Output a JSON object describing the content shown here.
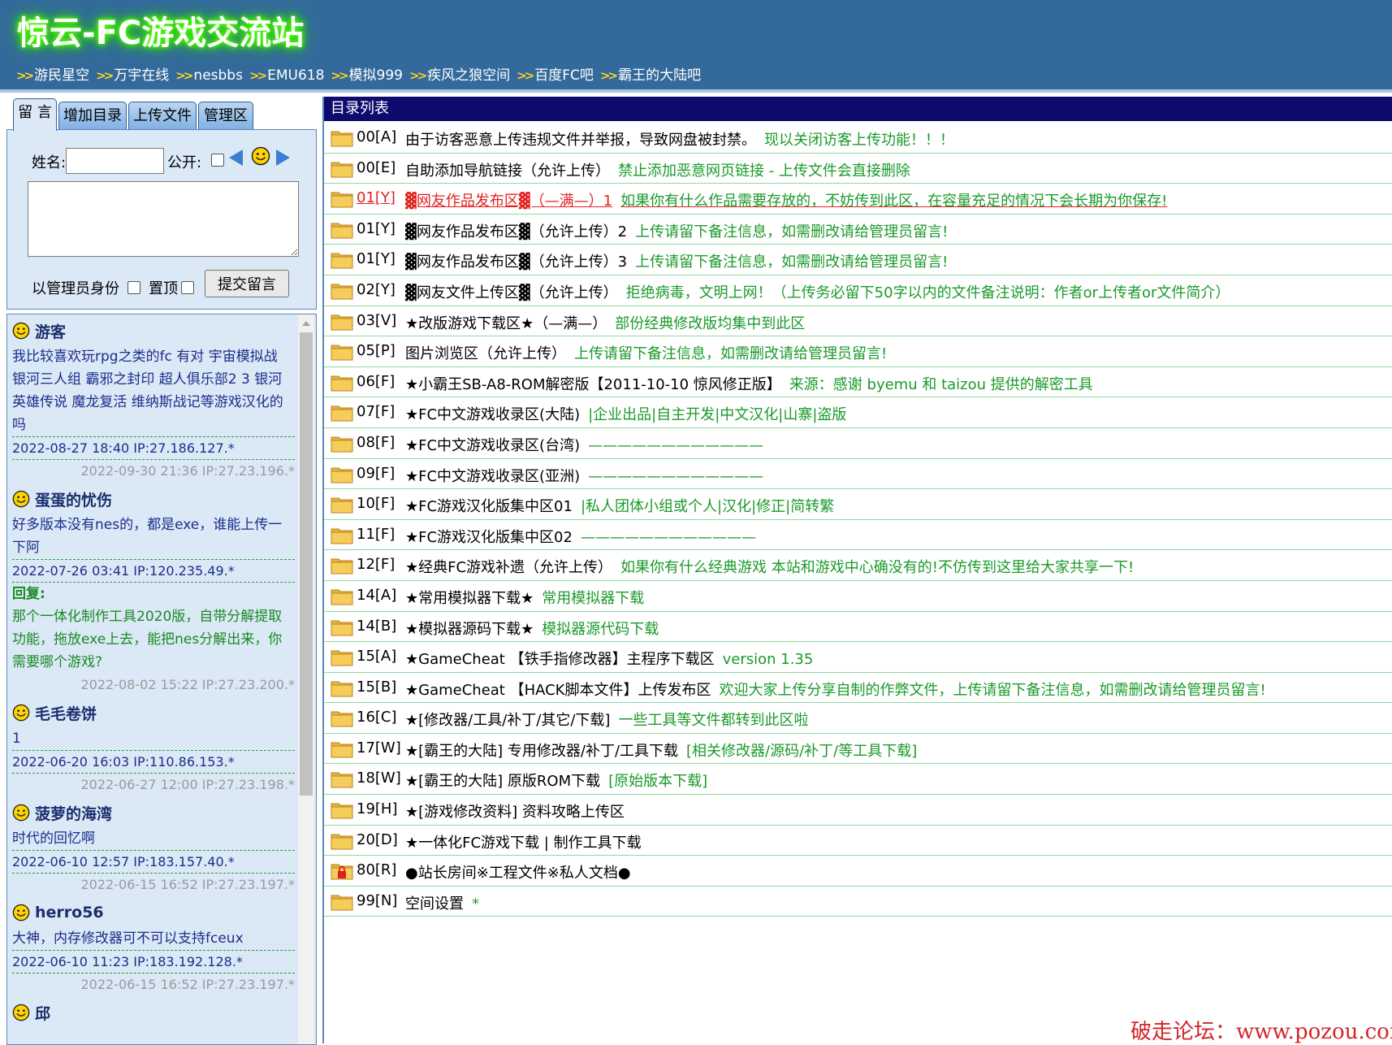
{
  "site_title": "惊云-FC游戏交流站",
  "nav_links": [
    "游民星空",
    "万宇在线",
    "nesbbs",
    "EMU618",
    "模拟999",
    "疾风之狼空间",
    "百度FC吧",
    "霸王的大陆吧"
  ],
  "tabs": [
    "留 言",
    "增加目录",
    "上传文件",
    "管理区"
  ],
  "form": {
    "name_label": "姓名:",
    "name_value": "",
    "public_label": "公开:",
    "admin_label": "以管理员身份",
    "pin_label": "置顶",
    "submit_label": "提交留言"
  },
  "messages": [
    {
      "name": "游客",
      "text": "我比较喜欢玩rpg之类的fc 有对 宇宙模拟战 银河三人组 霸邪之封印 超人俱乐部2 3 银河英雄传说 魔龙复活 维纳斯战记等游戏汉化的吗",
      "posted": "2022-08-27 18:40 IP:27.186.127.*",
      "reply_title": "",
      "reply": "",
      "replied": "2022-09-30 21:36 IP:27.23.196.*"
    },
    {
      "name": "蛋蛋的忧伤",
      "text": "好多版本没有nes的，都是exe，谁能上传一下阿",
      "posted": "2022-07-26 03:41 IP:120.235.49.*",
      "reply_title": "回复:",
      "reply": "那个一体化制作工具2020版，自带分解提取功能，拖放exe上去，能把nes分解出来，你需要哪个游戏?",
      "replied": "2022-08-02 15:22 IP:27.23.200.*"
    },
    {
      "name": "毛毛卷饼",
      "text": "1",
      "posted": "2022-06-20 16:03 IP:110.86.153.*",
      "reply_title": "",
      "reply": "",
      "replied": "2022-06-27 12:00 IP:27.23.198.*"
    },
    {
      "name": "菠萝的海湾",
      "text": "时代的回忆啊",
      "posted": "2022-06-10 12:57 IP:183.157.40.*",
      "reply_title": "",
      "reply": "",
      "replied": "2022-06-15 16:52 IP:27.23.197.*"
    },
    {
      "name": "herro56",
      "text": "大神，内存修改器可不可以支持fceux",
      "posted": "2022-06-10 11:23 IP:183.192.128.*",
      "reply_title": "",
      "reply": "",
      "replied": "2022-06-15 16:52 IP:27.23.197.*"
    },
    {
      "name": "邱",
      "text": "",
      "posted": "",
      "reply_title": "",
      "reply": "",
      "replied": ""
    }
  ],
  "directory": {
    "header": "目录列表",
    "rows": [
      {
        "code": "00[A]",
        "title": "由于访客恶意上传违规文件并举报，导致网盘被封禁。",
        "desc": "现以关闭访客上传功能！！！",
        "icon": "folder-icon",
        "highlight": false
      },
      {
        "code": "00[E]",
        "title": "自助添加导航链接（允许上传）",
        "desc": "禁止添加恶意网页链接 - 上传文件会直接删除",
        "icon": "folder-icon",
        "highlight": false
      },
      {
        "code": "01[Y]",
        "title": "▓网友作品发布区▓（—满—）1",
        "desc": "如果你有什么作品需要存放的，不妨传到此区，在容量充足的情况下会长期为你保存!",
        "icon": "folder-icon",
        "highlight": true
      },
      {
        "code": "01[Y]",
        "title": "▓网友作品发布区▓（允许上传）2",
        "desc": "上传请留下备注信息，如需删改请给管理员留言!",
        "icon": "folder-icon",
        "highlight": false
      },
      {
        "code": "01[Y]",
        "title": "▓网友作品发布区▓（允许上传）3",
        "desc": "上传请留下备注信息，如需删改请给管理员留言!",
        "icon": "folder-icon",
        "highlight": false
      },
      {
        "code": "02[Y]",
        "title": "▓网友文件上传区▓（允许上传）",
        "desc": "拒绝病毒，文明上网！（上传务必留下50字以内的文件备注说明：作者or上传者or文件简介）",
        "icon": "folder-icon",
        "highlight": false
      },
      {
        "code": "03[V]",
        "title": "★改版游戏下载区★（—满—）",
        "desc": "部份经典修改版均集中到此区",
        "icon": "folder-icon",
        "highlight": false
      },
      {
        "code": "05[P]",
        "title": "图片浏览区（允许上传）",
        "desc": "上传请留下备注信息，如需删改请给管理员留言!",
        "icon": "folder-icon",
        "highlight": false
      },
      {
        "code": "06[F]",
        "title": "★小霸王SB-A8-ROM解密版【2011-10-10 惊风修正版】",
        "desc": "来源：感谢 byemu 和 taizou 提供的解密工具",
        "icon": "folder-icon",
        "highlight": false
      },
      {
        "code": "07[F]",
        "title": "★FC中文游戏收录区(大陆)",
        "desc": "|企业出品|自主开发|中文汉化|山寨|盗版",
        "icon": "folder-icon",
        "highlight": false
      },
      {
        "code": "08[F]",
        "title": "★FC中文游戏收录区(台湾)",
        "desc": "————————————",
        "icon": "folder-icon",
        "highlight": false
      },
      {
        "code": "09[F]",
        "title": "★FC中文游戏收录区(亚洲)",
        "desc": "————————————",
        "icon": "folder-icon",
        "highlight": false
      },
      {
        "code": "10[F]",
        "title": "★FC游戏汉化版集中区01",
        "desc": "|私人团体小组或个人|汉化|修正|简转繁",
        "icon": "folder-icon",
        "highlight": false
      },
      {
        "code": "11[F]",
        "title": "★FC游戏汉化版集中区02",
        "desc": "————————————",
        "icon": "folder-icon",
        "highlight": false
      },
      {
        "code": "12[F]",
        "title": "★经典FC游戏补遗（允许上传）",
        "desc": "如果你有什么经典游戏 本站和游戏中心确没有的!不仿传到这里给大家共享一下!",
        "icon": "folder-icon",
        "highlight": false
      },
      {
        "code": "14[A]",
        "title": "★常用模拟器下载★",
        "desc": "常用模拟器下载",
        "icon": "folder-icon",
        "highlight": false
      },
      {
        "code": "14[B]",
        "title": "★模拟器源码下载★",
        "desc": "模拟器源代码下载",
        "icon": "folder-icon",
        "highlight": false
      },
      {
        "code": "15[A]",
        "title": "★GameCheat 【铁手指修改器】主程序下载区",
        "desc": "version 1.35",
        "icon": "folder-icon",
        "highlight": false
      },
      {
        "code": "15[B]",
        "title": "★GameCheat 【HACK脚本文件】上传发布区",
        "desc": "欢迎大家上传分享自制的作弊文件，上传请留下备注信息，如需删改请给管理员留言!",
        "icon": "folder-icon",
        "highlight": false
      },
      {
        "code": "16[C]",
        "title": "★[修改器/工具/补丁/其它/下载]",
        "desc": "一些工具等文件都转到此区啦",
        "icon": "folder-icon",
        "highlight": false
      },
      {
        "code": "17[W]",
        "title": " ★[霸王的大陆] 专用修改器/补丁/工具下载",
        "desc": "[相关修改器/源码/补丁/等工具下载]",
        "icon": "folder-icon",
        "highlight": false
      },
      {
        "code": "18[W]",
        "title": " ★[霸王的大陆] 原版ROM下载",
        "desc": "[原始版本下载]",
        "icon": "folder-icon",
        "highlight": false
      },
      {
        "code": "19[H]",
        "title": "★[游戏修改资料] 资料攻略上传区",
        "desc": "",
        "icon": "folder-icon",
        "highlight": false
      },
      {
        "code": "20[D]",
        "title": "★一体化FC游戏下载 | 制作工具下载",
        "desc": "",
        "icon": "folder-icon",
        "highlight": false
      },
      {
        "code": "80[R]",
        "title": "●站长房间※工程文件※私人文档●",
        "desc": "",
        "icon": "locked-folder-icon",
        "highlight": false
      },
      {
        "code": "99[N]",
        "title": "空间设置",
        "desc": "*",
        "icon": "folder-icon",
        "highlight": false
      }
    ]
  },
  "watermark": "破走论坛：www.pozou.com"
}
